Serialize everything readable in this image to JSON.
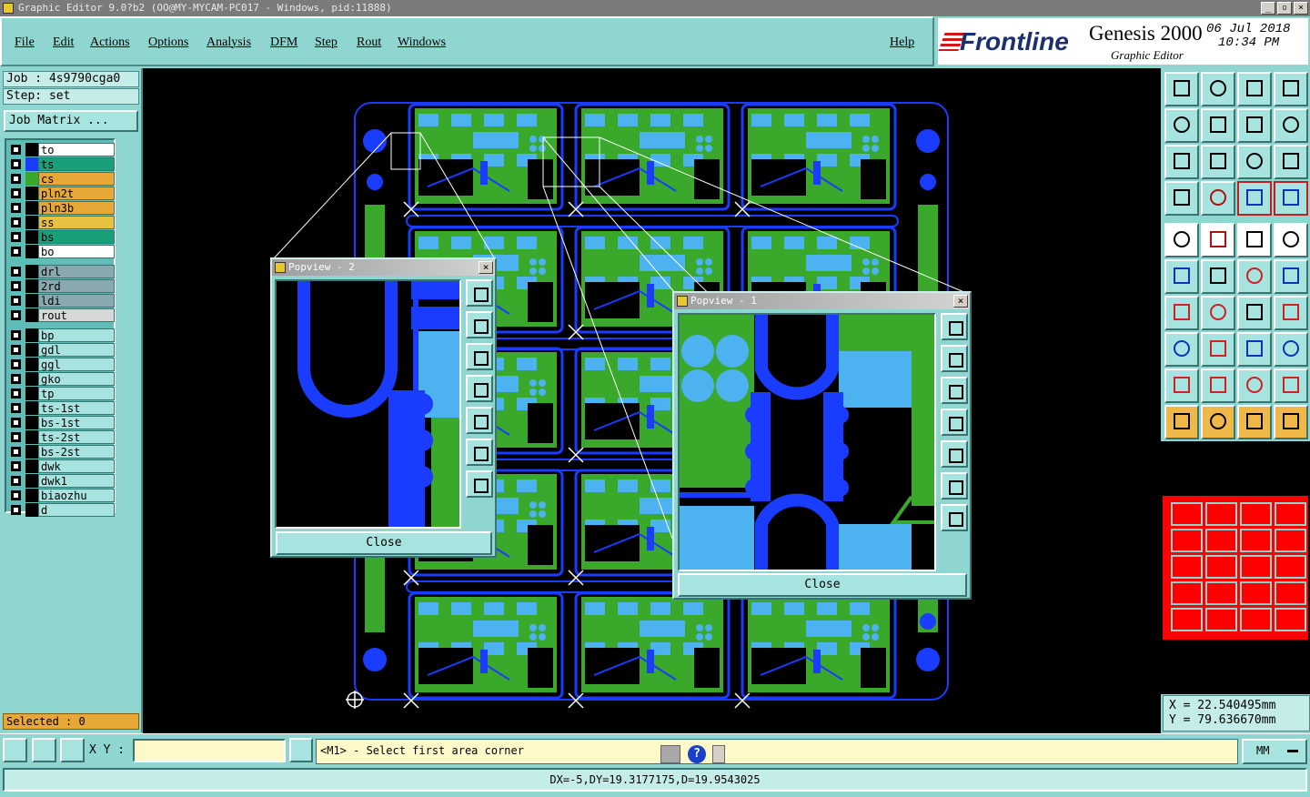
{
  "window": {
    "title": "Graphic Editor 9.0?b2 (OO@MY-MYCAM-PC017 - Windows, pid:11888)",
    "controls": [
      "_",
      "▫",
      "×"
    ]
  },
  "menu": {
    "items": [
      "File",
      "Edit",
      "Actions",
      "Options",
      "Analysis",
      "DFM",
      "Step",
      "Rout",
      "Windows"
    ],
    "help": "Help"
  },
  "brand": {
    "logo": "Frontline",
    "product": "Genesis 2000",
    "subtitle": "Graphic Editor",
    "date": "06 Jul 2018",
    "time": "10:34 PM"
  },
  "job": {
    "job_label": "Job : 4s9790cga0",
    "step_label": "Step: set",
    "matrix_button": "Job Matrix ..."
  },
  "layers": [
    {
      "name": "to",
      "swatch": "#000000",
      "bg": "#ffffff"
    },
    {
      "name": "ts",
      "swatch": "#1a3cff",
      "bg": "#19a07a"
    },
    {
      "name": "cs",
      "swatch": "#3aa82a",
      "bg": "#e8a838"
    },
    {
      "name": "pln2t",
      "swatch": "#000000",
      "bg": "#e8a838"
    },
    {
      "name": "pln3b",
      "swatch": "#000000",
      "bg": "#e8a838"
    },
    {
      "name": "ss",
      "swatch": "#000000",
      "bg": "#e8c040"
    },
    {
      "name": "bs",
      "swatch": "#000000",
      "bg": "#19a07a"
    },
    {
      "name": "bo",
      "swatch": "#000000",
      "bg": "#ffffff"
    },
    {
      "name": "drl",
      "swatch": "#000000",
      "bg": "#8aa8b0"
    },
    {
      "name": "2rd",
      "swatch": "#000000",
      "bg": "#8aa8b0"
    },
    {
      "name": "ldi",
      "swatch": "#000000",
      "bg": "#8aa8b0"
    },
    {
      "name": "rout",
      "swatch": "#000000",
      "bg": "#d8d8d8"
    },
    {
      "name": "bp",
      "swatch": "#000000",
      "bg": "#a8e4df"
    },
    {
      "name": "gdl",
      "swatch": "#000000",
      "bg": "#a8e4df"
    },
    {
      "name": "ggl",
      "swatch": "#000000",
      "bg": "#a8e4df"
    },
    {
      "name": "gko",
      "swatch": "#000000",
      "bg": "#a8e4df"
    },
    {
      "name": "tp",
      "swatch": "#000000",
      "bg": "#a8e4df"
    },
    {
      "name": "ts-1st",
      "swatch": "#000000",
      "bg": "#a8e4df"
    },
    {
      "name": "bs-1st",
      "swatch": "#000000",
      "bg": "#a8e4df"
    },
    {
      "name": "ts-2st",
      "swatch": "#000000",
      "bg": "#a8e4df"
    },
    {
      "name": "bs-2st",
      "swatch": "#000000",
      "bg": "#a8e4df"
    },
    {
      "name": "dwk",
      "swatch": "#000000",
      "bg": "#a8e4df"
    },
    {
      "name": "dwk1",
      "swatch": "#000000",
      "bg": "#a8e4df"
    },
    {
      "name": "biaozhu",
      "swatch": "#000000",
      "bg": "#a8e4df"
    },
    {
      "name": "d",
      "swatch": "#000000",
      "bg": "#a8e4df"
    }
  ],
  "selected_label": "Selected : 0",
  "popviews": [
    {
      "title": "Popview - 2",
      "close_label": "Close"
    },
    {
      "title": "Popview - 1",
      "close_label": "Close"
    }
  ],
  "coords": {
    "x": "X  = 22.540495mm",
    "y": "Y  = 79.636670mm"
  },
  "bottom": {
    "xy_label": "X Y :",
    "xy_value": "",
    "prompt": "<M1> - Select first area corner",
    "units": "MM",
    "status": "DX=-5,DY=19.3177175,D=19.9543025"
  },
  "colors": {
    "panel": "#8fd6d1",
    "copper": "#1a3cff",
    "mask": "#3aa82a",
    "pads": "#4db2f0",
    "overview_fill": "#ff0000"
  }
}
